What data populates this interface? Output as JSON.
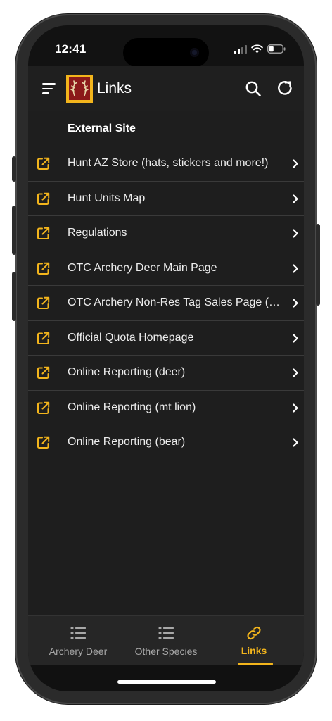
{
  "status_bar": {
    "time": "12:41"
  },
  "app_bar": {
    "title": "Links"
  },
  "section": {
    "header": "External Site"
  },
  "links": [
    {
      "label": "Hunt AZ Store (hats, stickers and more!)"
    },
    {
      "label": "Hunt Units Map"
    },
    {
      "label": "Regulations"
    },
    {
      "label": "OTC Archery Deer Main Page"
    },
    {
      "label": "OTC Archery Non-Res Tag Sales Page (sold out)"
    },
    {
      "label": "Official Quota Homepage"
    },
    {
      "label": "Online Reporting (deer)"
    },
    {
      "label": "Online Reporting (mt lion)"
    },
    {
      "label": "Online Reporting (bear)"
    }
  ],
  "tabs": [
    {
      "label": "Archery Deer",
      "icon": "list-icon"
    },
    {
      "label": "Other Species",
      "icon": "list-icon"
    },
    {
      "label": "Links",
      "icon": "link-icon",
      "active": true
    }
  ],
  "colors": {
    "accent": "#f3b51c",
    "background": "#1e1e1e",
    "app_bar": "#1f1f1f",
    "divider": "#3a3a3a"
  }
}
